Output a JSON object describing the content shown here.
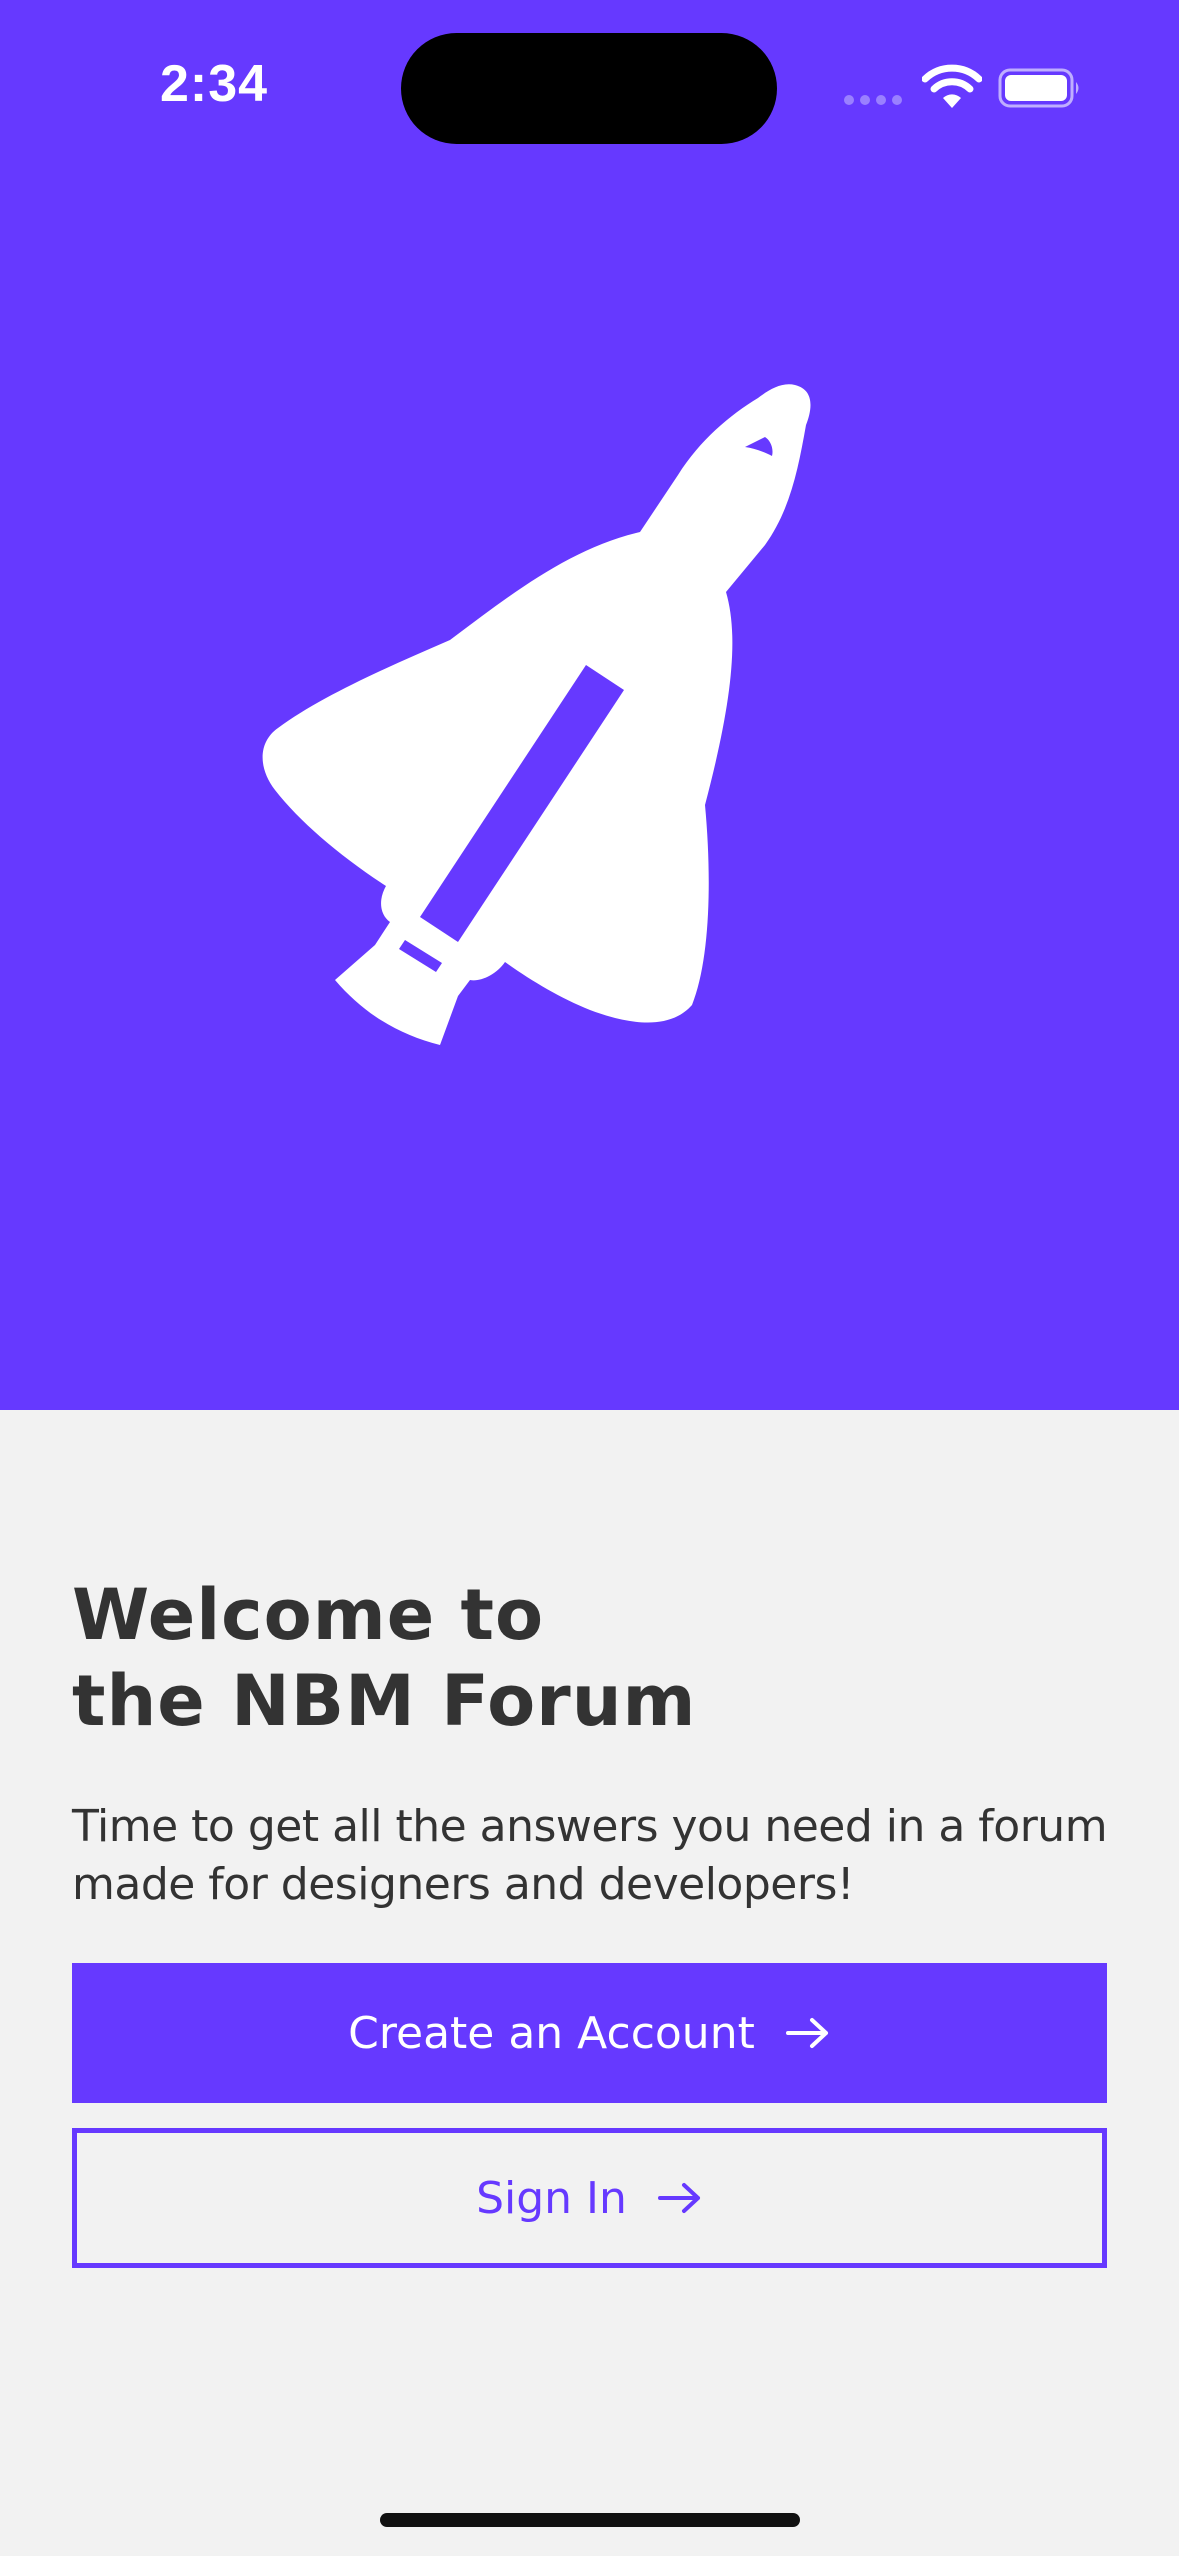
{
  "status_bar": {
    "time": "2:34",
    "icons": [
      "cellular-signal-icon",
      "wifi-icon",
      "battery-icon"
    ]
  },
  "hero": {
    "background_color": "#6639ff",
    "illustration": "space-shuttle-icon"
  },
  "welcome": {
    "title": "Welcome to\nthe NBM Forum",
    "subtitle": "Time to get all the answers you need in a forum made for designers and developers!"
  },
  "actions": {
    "create_account_label": "Create an Account",
    "sign_in_label": "Sign In",
    "arrow_icon": "arrow-right-icon"
  },
  "colors": {
    "accent": "#6639ff",
    "background": "#f2f2f2",
    "text": "#333333"
  }
}
